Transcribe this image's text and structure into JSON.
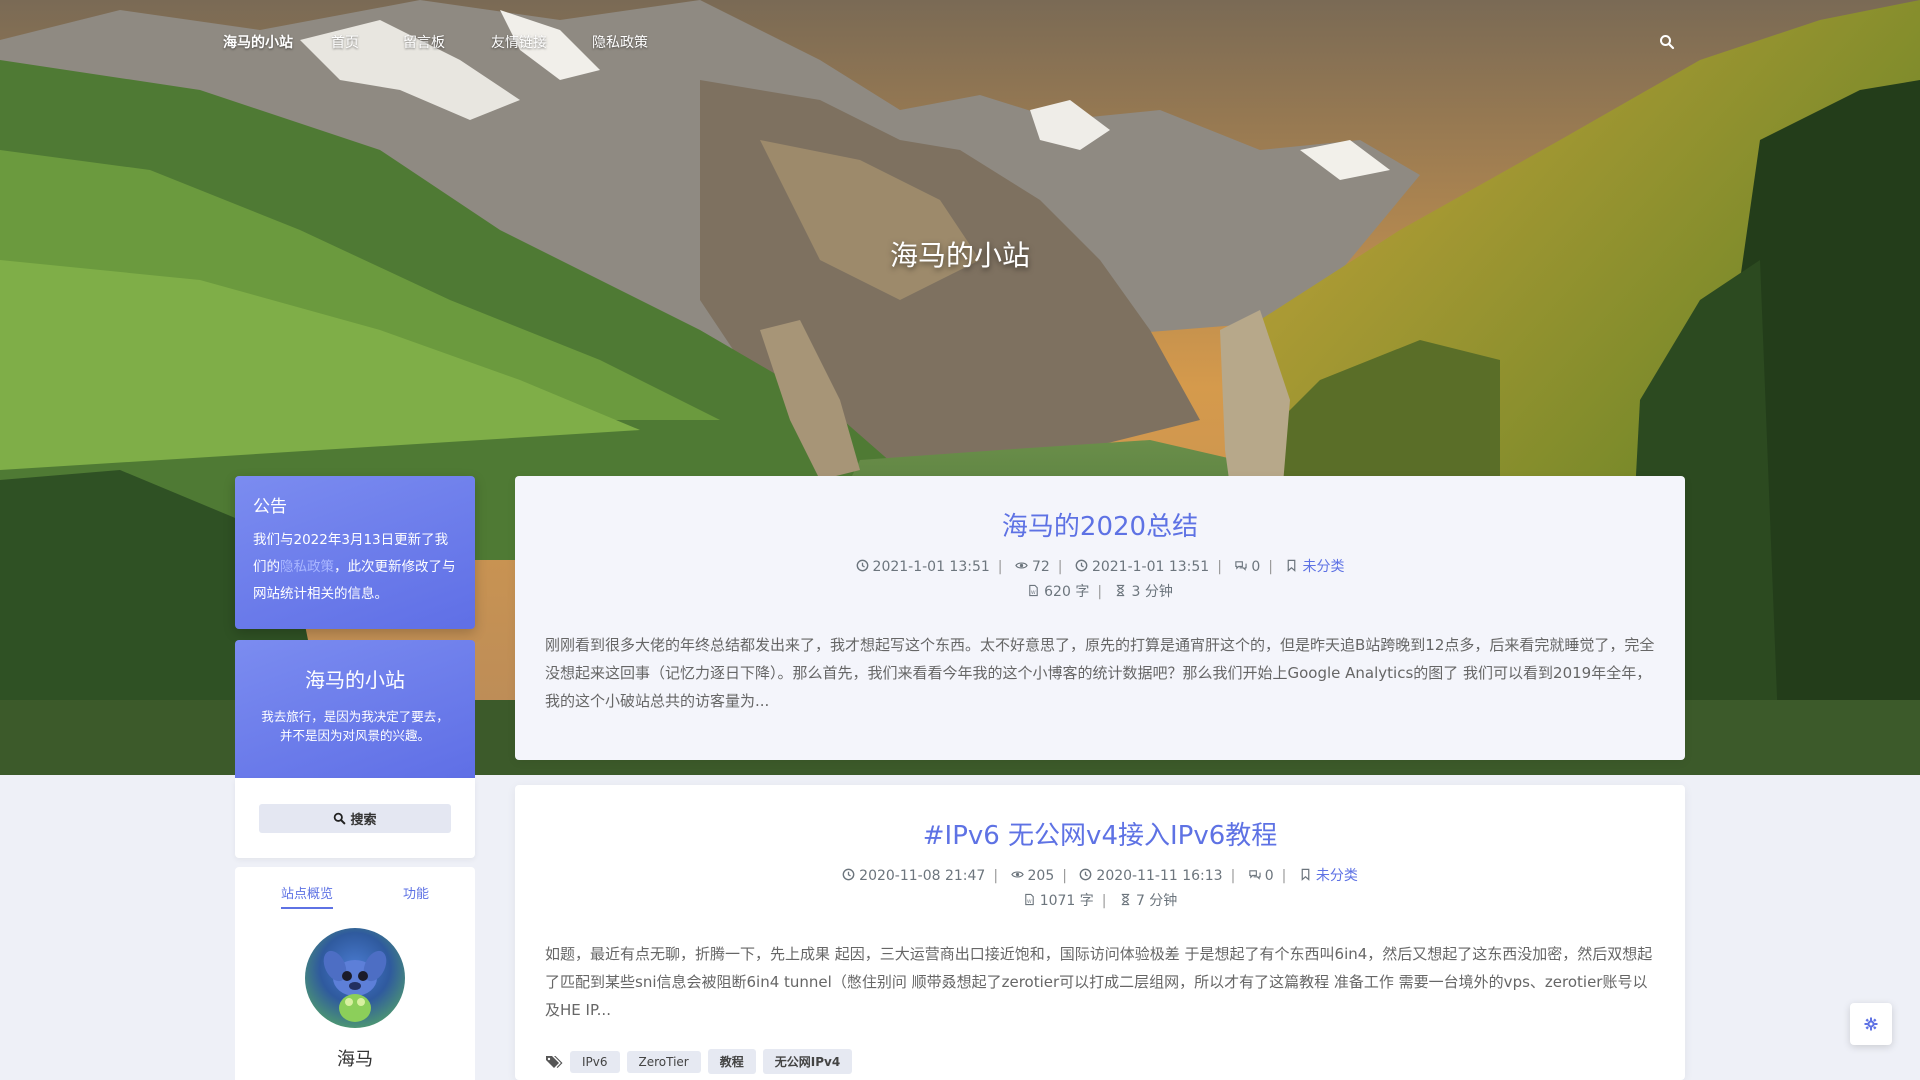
{
  "nav": {
    "brand": "海马的小站",
    "items": [
      "首页",
      "留言板",
      "友情链接",
      "隐私政策"
    ],
    "search_icon": "search-icon"
  },
  "banner": {
    "site_title": "海马的小站"
  },
  "sidebar": {
    "announcement": {
      "title": "公告",
      "text_before": "我们与2022年3月13日更新了我们的",
      "link_text": "隐私政策",
      "text_after": "，此次更新修改了与网站统计相关的信息。"
    },
    "site_card": {
      "name": "海马的小站",
      "description": "我去旅行，是因为我决定了要去，并不是因为对风景的兴趣。"
    },
    "search_button": "搜索",
    "tabs": [
      "站点概览",
      "功能"
    ],
    "profile_name": "海马"
  },
  "posts": [
    {
      "title": "海马的2020总结",
      "published": "2021-1-01 13:51",
      "views": "72",
      "modified": "2021-1-01 13:51",
      "comments": "0",
      "category": "未分类",
      "words": "620 字",
      "read_time": "3 分钟",
      "excerpt": "刚刚看到很多大佬的年终总结都发出来了，我才想起写这个东西。太不好意思了，原先的打算是通宵肝这个的，但是昨天追B站跨晚到12点多，后来看完就睡觉了，完全没想起来这回事（记忆力逐日下降）。那么首先，我们来看看今年我的这个小博客的统计数据吧？那么我们开始上Google Analytics的图了 我们可以看到2019年全年，我的这个小破站总共的访客量为..."
    },
    {
      "title": "#IPv6 无公网v4接入IPv6教程",
      "published": "2020-11-08 21:47",
      "views": "205",
      "modified": "2020-11-11 16:13",
      "comments": "0",
      "category": "未分类",
      "words": "1071 字",
      "read_time": "7 分钟",
      "excerpt": "如题，最近有点无聊，折腾一下，先上成果 起因，三大运营商出口接近饱和，国际访问体验极差 于是想起了有个东西叫6in4，然后又想起了这东西没加密，然后双想起了匹配到某些sni信息会被阻断6in4 tunnel（憋住别问 顺带叒想起了zerotier可以打成二层组网，所以才有了这篇教程 准备工作 需要一台境外的vps、zerotier账号以及HE IP...",
      "tags": [
        "IPv6",
        "ZeroTier",
        "教程",
        "无公网IPv4"
      ]
    }
  ],
  "colors": {
    "accent": "#5e72e4",
    "card_gradient_start": "#7b8cf0",
    "card_gradient_end": "#5f6fe6"
  },
  "float_button_icon": "gear-icon"
}
